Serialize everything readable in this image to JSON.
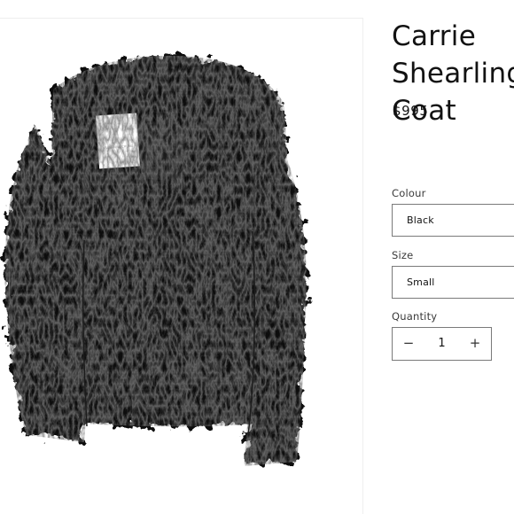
{
  "product": {
    "title": "Carrie Shearling Coat",
    "price": "$995",
    "image_alt": "black-fur-coat-photo",
    "image_tag_text": "SUSANNA CHUNG"
  },
  "options": {
    "colour": {
      "label": "Colour",
      "value": "Black"
    },
    "size": {
      "label": "Size",
      "value": "Small"
    }
  },
  "quantity": {
    "label": "Quantity",
    "value": "1",
    "minus_symbol": "−",
    "plus_symbol": "+"
  },
  "colors": {
    "fur": "#0b0b0b",
    "border": "#7a7a7a",
    "text": "#121212"
  }
}
